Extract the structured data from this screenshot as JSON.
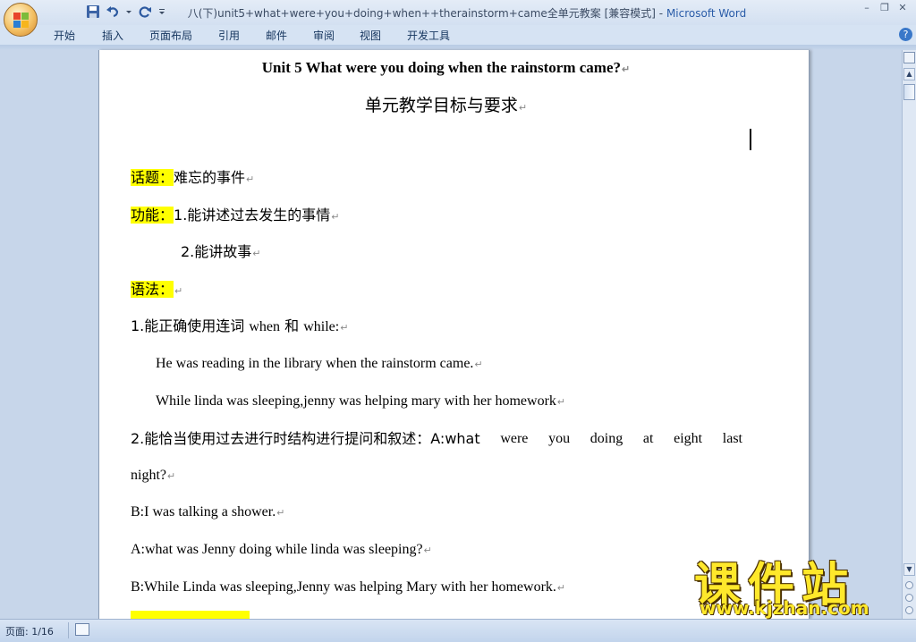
{
  "window": {
    "doc_name": "八(下)unit5+what+were+you+doing+when++therainstorm+came全单元教案 [兼容模式]",
    "separator": " - ",
    "app_name": "Microsoft Word"
  },
  "ribbon": {
    "tabs": [
      "开始",
      "插入",
      "页面布局",
      "引用",
      "邮件",
      "审阅",
      "视图",
      "开发工具"
    ],
    "help_label": "?"
  },
  "document": {
    "title": "Unit 5 What were you doing when the rainstorm came?",
    "subtitle": "单元教学目标与要求",
    "topic_label": "话题：",
    "topic_text": "难忘的事件",
    "function_label": "功能：",
    "function_item1": "1.能讲述过去发生的事情",
    "function_item2": "2.能讲故事",
    "grammar_label": "语法：",
    "grammar_point1_cn": "1.能正确使用连词 ",
    "grammar_point1_w1": "when",
    "grammar_point1_and": " 和 ",
    "grammar_point1_w2": "while:",
    "example1": "He was reading in the library when the rainstorm came.",
    "example2": "While linda was sleeping,jenny was helping mary with her homework",
    "grammar_point2_words": [
      "2.能恰当使用过去进行时结构进行提问和叙述：A:what",
      "were",
      "you",
      "doing",
      "at",
      "eight",
      "last"
    ],
    "grammar_point2_cont": "night?",
    "dialog_b1": "B:I was talking a shower.",
    "dialog_a2": "A:what was Jenny doing while linda was sleeping?",
    "dialog_b2": "B:While Linda was sleeping,Jenny was helping Mary with her homework.",
    "paragraph_mark": "↵"
  },
  "status": {
    "page": "页面: 1/16"
  },
  "watermark": {
    "name": "课件站",
    "url": "www.kjzhan.com"
  },
  "colors": {
    "highlight": "#ffff00",
    "workspace": "#c7d6ea",
    "title_app": "#2a5ca8"
  }
}
